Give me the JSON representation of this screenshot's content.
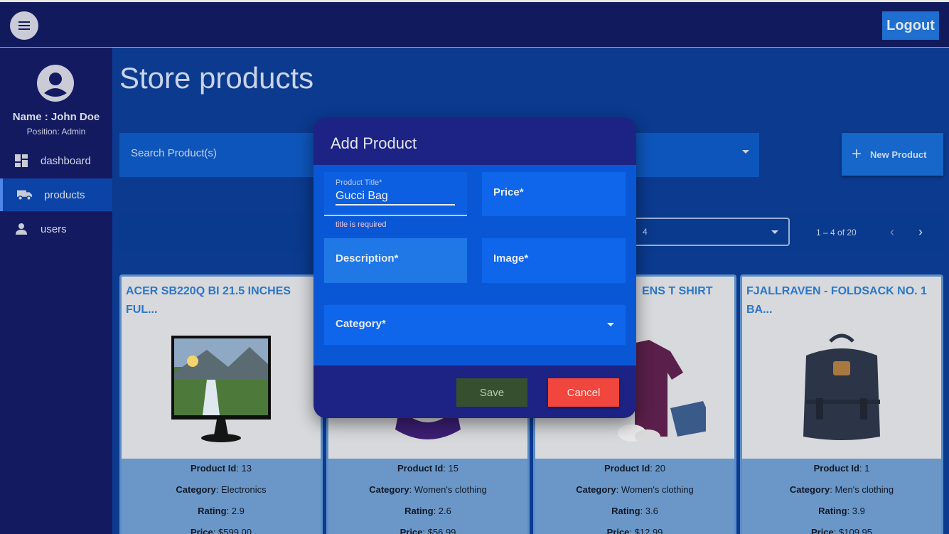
{
  "header": {
    "logout_label": "Logout"
  },
  "sidebar": {
    "user_name": "Name : John Doe",
    "user_position": "Position: Admin",
    "items": [
      {
        "label": "dashboard",
        "icon": "dashboard-icon"
      },
      {
        "label": "products",
        "icon": "truck-icon",
        "active": true
      },
      {
        "label": "users",
        "icon": "person-icon"
      }
    ]
  },
  "main": {
    "title": "Store products",
    "search_placeholder": "Search Product(s)",
    "new_product_label": "New Product",
    "pager": {
      "per_page": "4",
      "range": "1 – 4 of 20"
    }
  },
  "products": [
    {
      "title": "ACER SB220Q BI 21.5 INCHES FUL...",
      "id_label": "Product Id",
      "id": "13",
      "category_label": "Category",
      "category": "Electronics",
      "rating_label": "Rating",
      "rating": "2.9",
      "price_label": "Price",
      "price": "$599.00"
    },
    {
      "title": "",
      "id_label": "Product Id",
      "id": "15",
      "category_label": "Category",
      "category": "Women's clothing",
      "rating_label": "Rating",
      "rating": "2.6",
      "price_label": "Price",
      "price": "$56.99"
    },
    {
      "title": "ENS T SHIRT",
      "id_label": "Product Id",
      "id": "20",
      "category_label": "Category",
      "category": "Women's clothing",
      "rating_label": "Rating",
      "rating": "3.6",
      "price_label": "Price",
      "price": "$12.99"
    },
    {
      "title": "FJALLRAVEN - FOLDSACK NO. 1 BA...",
      "id_label": "Product Id",
      "id": "1",
      "category_label": "Category",
      "category": "Men's clothing",
      "rating_label": "Rating",
      "rating": "3.9",
      "price_label": "Price",
      "price": "$109.95"
    }
  ],
  "dialog": {
    "title": "Add Product",
    "title_field": {
      "label": "Product Title*",
      "value": "Gucci Bag",
      "error": "title is required"
    },
    "price_label": "Price*",
    "description_label": "Description*",
    "image_label": "Image*",
    "category_label": "Category*",
    "save_label": "Save",
    "cancel_label": "Cancel"
  },
  "colors": {
    "accent": "#0a57d6",
    "cancel": "#f1463d",
    "save": "#36502f",
    "sidebar": "#141a60"
  }
}
